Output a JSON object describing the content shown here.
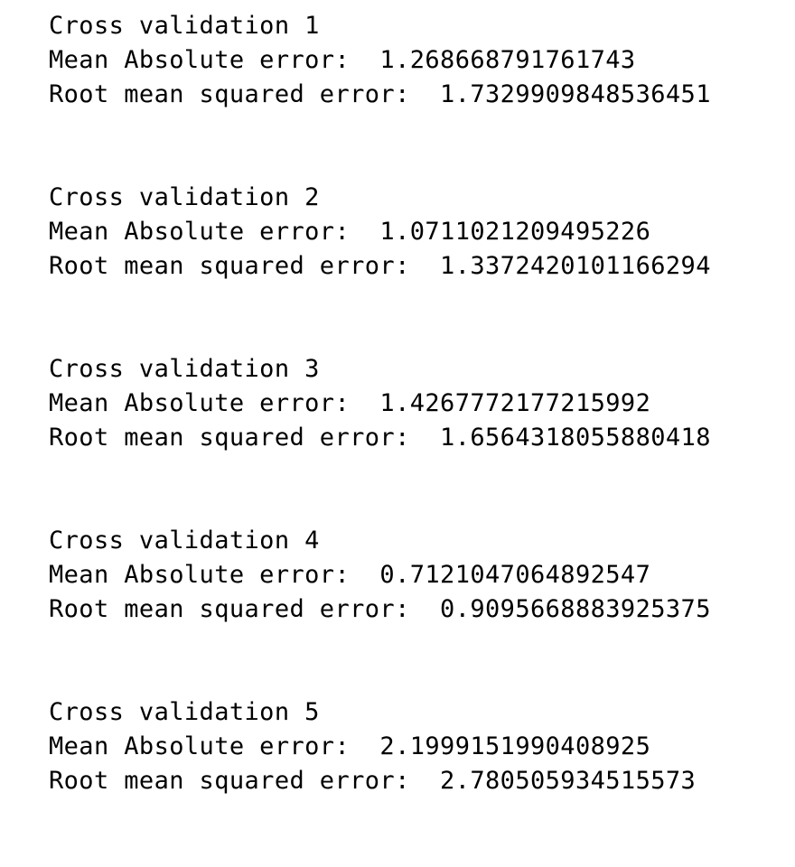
{
  "folds": [
    {
      "header": "Cross validation 1",
      "mae_label": "Mean Absolute error:",
      "mae_value": "1.268668791761743",
      "rmse_label": "Root mean squared error:",
      "rmse_value": "1.7329909848536451"
    },
    {
      "header": "Cross validation 2",
      "mae_label": "Mean Absolute error:",
      "mae_value": "1.0711021209495226",
      "rmse_label": "Root mean squared error:",
      "rmse_value": "1.3372420101166294"
    },
    {
      "header": "Cross validation 3",
      "mae_label": "Mean Absolute error:",
      "mae_value": "1.4267772177215992",
      "rmse_label": "Root mean squared error:",
      "rmse_value": "1.6564318055880418"
    },
    {
      "header": "Cross validation 4",
      "mae_label": "Mean Absolute error:",
      "mae_value": "0.7121047064892547",
      "rmse_label": "Root mean squared error:",
      "rmse_value": "0.9095668883925375"
    },
    {
      "header": "Cross validation 5",
      "mae_label": "Mean Absolute error:",
      "mae_value": "2.1999151990408925",
      "rmse_label": "Root mean squared error:",
      "rmse_value": "2.780505934515573"
    }
  ]
}
